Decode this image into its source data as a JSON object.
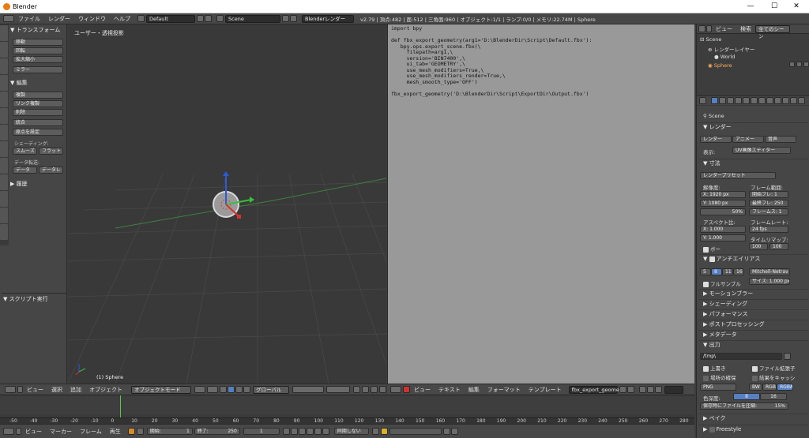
{
  "window": {
    "title": "Blender",
    "min": "—",
    "max": "☐",
    "close": "✕"
  },
  "infobar": {
    "menus": [
      "ファイル",
      "レンダー",
      "ウィンドウ",
      "ヘルプ"
    ],
    "screen": "Default",
    "scene": "Scene",
    "engine": "Blenderレンダー",
    "stats": "v2.79 | 頂点:482 | 面:512 | 三角面:960 | オブジェクト:1/1 | ランプ:0/0 | メモリ:22.74M | Sphere"
  },
  "tool": {
    "transform_header": "トランスフォーム",
    "transform": [
      "移動",
      "回転",
      "拡大縮小"
    ],
    "mirror": "ミラー",
    "edit_header": "編集",
    "edit": [
      "複製",
      "リンク複製",
      "削除"
    ],
    "join": "統合",
    "origin": "原点を設定",
    "shading_label": "シェーディング:",
    "smooth": "スムーズ",
    "flat": "フラット",
    "data_label": "データ転送:",
    "data": "データ",
    "data2": "データレ",
    "history": "履歴",
    "script_header": "スクリプト実行"
  },
  "viewport": {
    "label": "ユーザー・透視投影",
    "object": "(1) Sphere"
  },
  "vfooter": {
    "menus": [
      "ビュー",
      "選択",
      "追加",
      "オブジェクト"
    ],
    "mode": "オブジェクトモード",
    "orient": "グローバル"
  },
  "text": {
    "code": "import bpy\n\ndef fbx_export_geometry(arg1='D:\\BlenderDir\\Script\\Default.fbx'):\n   bpy.ops.export_scene.fbx(\\\n     filepath=arg1,\\\n     version='BIN7400',\\\n     ui_tab='GEOMETRY',\\\n     use_mesh_modifiers=True,\\\n     use_mesh_modifiers_render=True,\\\n     mesh_smooth_type='OFF')\n\nfbx_export_geometry('D:\\BlenderDir\\Script\\ExportDir\\Output.fbx')"
  },
  "tfooter": {
    "menus": [
      "ビュー",
      "テキスト",
      "編集",
      "フォーマット",
      "テンプレート"
    ],
    "file": "fbx_export_geometr"
  },
  "outliner": {
    "view": "ビュー",
    "search": "検索",
    "filter": "全てのシーン",
    "items": [
      "Scene",
      "レンダーレイヤー",
      "World",
      "Sphere"
    ]
  },
  "props": {
    "scene": "Scene",
    "render": "レンダー",
    "btn_render": "レンダー",
    "btn_anim": "アニメー",
    "btn_audio": "音声",
    "display_label": "表示:",
    "display": "UV画像エディター",
    "dims": "寸法",
    "preset": "レンダープリセット",
    "resolution": "解像度:",
    "res_x": "X:",
    "res_x_val": "1920 px",
    "res_y": "Y:",
    "res_y_val": "1080 px",
    "res_pct": "50%",
    "frame_range": "フレーム範囲:",
    "start": "開始フレ:",
    "start_val": "1",
    "end": "最終フレ:",
    "end_val": "250",
    "step": "フレームス:",
    "step_val": "1",
    "aspect": "アスペクト比:",
    "ax": "X:",
    "ax_val": "1.000",
    "ay": "Y:",
    "ay_val": "1.000",
    "border": "ボー",
    "framerate_label": "フレームレート:",
    "fps": "24 fps",
    "remap": "タイムリマップ:",
    "remap1": "100",
    "remap2": "100",
    "aa": "アンチエイリアス",
    "aa_vals": [
      "5",
      "8",
      "11",
      "16"
    ],
    "aa_filter": "Mitchell-Netrav",
    "fullsample": "フルサンプル",
    "size": "サイズ: 1.000 px",
    "sections": [
      "モーションブラー",
      "シェーディング",
      "パフォーマンス",
      "ポストプロセッシング",
      "メタデータ"
    ],
    "output": "出力",
    "path": "/tmp\\",
    "overwrite": "上書き",
    "extensions": "ファイル拡張子",
    "placeholders": "場所の確保",
    "cache": "結果をキャッシ",
    "format": "PNG",
    "bw": "BW",
    "rgb": "RGB",
    "rgba": "RGBA",
    "depth_label": "色深度:",
    "depth8": "8",
    "depth16": "16",
    "compress": "保存時にファイルを圧縮:",
    "compress_val": "15%",
    "bake": "ベイク",
    "freestyle": "Freestyle"
  },
  "timeline": {
    "ticks": [
      "-50",
      "-40",
      "-30",
      "-20",
      "-10",
      "0",
      "10",
      "20",
      "30",
      "40",
      "50",
      "60",
      "70",
      "80",
      "90",
      "100",
      "110",
      "120",
      "130",
      "140",
      "150",
      "160",
      "170",
      "180",
      "190",
      "200",
      "210",
      "220",
      "230",
      "240",
      "250",
      "260",
      "270",
      "280"
    ]
  },
  "tlfooter": {
    "menus": [
      "ビュー",
      "マーカー",
      "フレーム",
      "再生"
    ],
    "start": "開始:",
    "start_val": "1",
    "end": "終了:",
    "end_val": "250",
    "current": "1",
    "sync": "同期しない"
  }
}
